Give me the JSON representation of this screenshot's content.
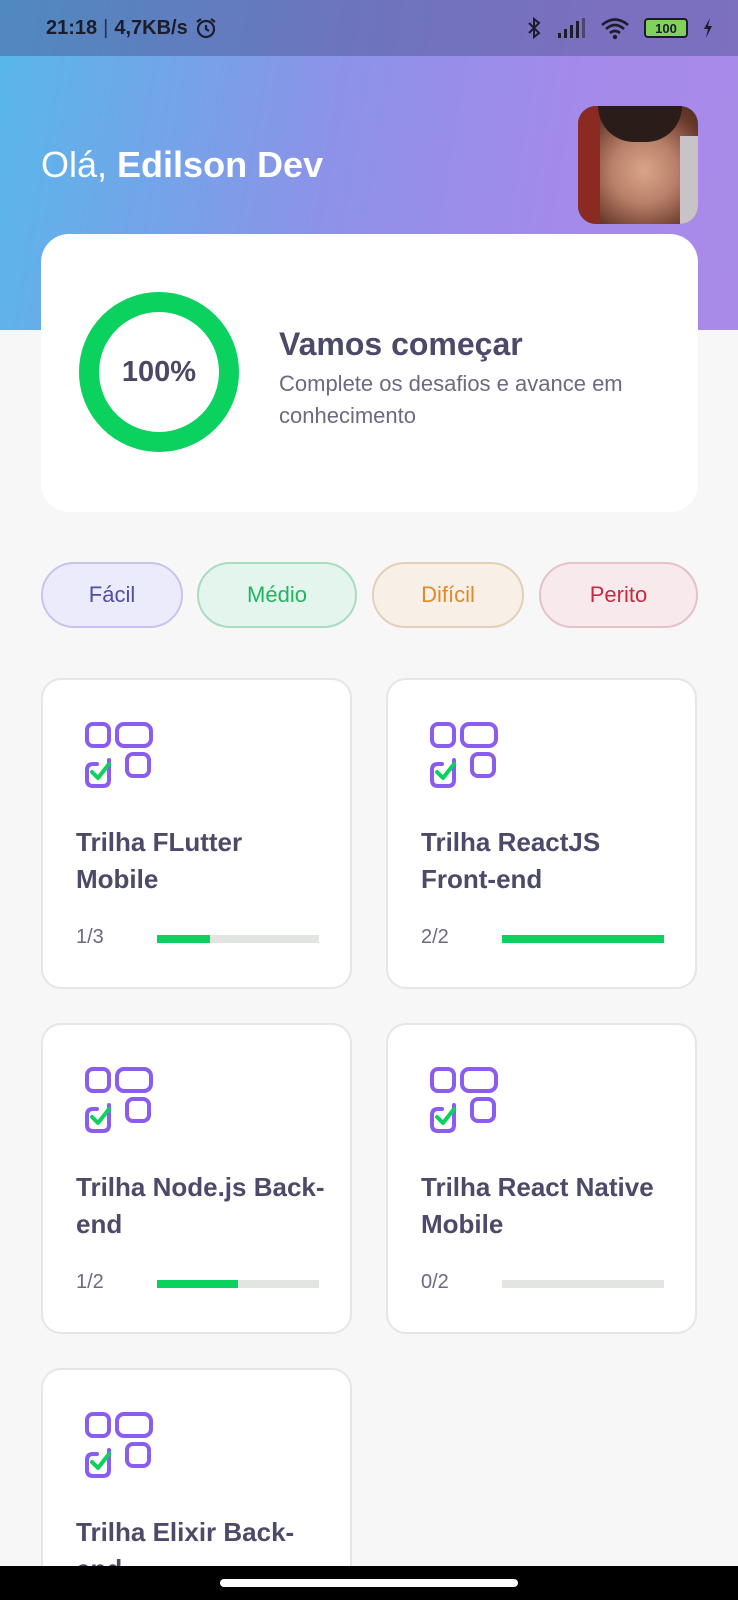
{
  "status_bar": {
    "time": "21:18",
    "speed": "4,7KB/s",
    "battery": "100",
    "icons": [
      "alarm-icon",
      "bluetooth-icon",
      "signal-icon",
      "wifi-icon",
      "battery-icon",
      "charging-icon"
    ]
  },
  "header": {
    "greeting_prefix": "Olá,",
    "user_name": "Edilson Dev"
  },
  "progress_card": {
    "percent_label": "100%",
    "percent": 100,
    "title": "Vamos começar",
    "subtitle": "Complete os desafios e avance em conhecimento",
    "ring_color": "#0bd15f"
  },
  "levels": [
    {
      "label": "Fácil"
    },
    {
      "label": "Médio"
    },
    {
      "label": "Difícil"
    },
    {
      "label": "Perito"
    }
  ],
  "tracks": [
    {
      "title": "Trilha FLutter Mobile",
      "count": "1/3",
      "progress": 0.333
    },
    {
      "title": "Trilha ReactJS Front-end",
      "count": "2/2",
      "progress": 1.0
    },
    {
      "title": "Trilha Node.js Back-end",
      "count": "1/2",
      "progress": 0.5
    },
    {
      "title": "Trilha React Native Mobile",
      "count": "0/2",
      "progress": 0.0
    },
    {
      "title": "Trilha Elixir Back-end",
      "count": "",
      "progress": 0.0
    }
  ],
  "colors": {
    "accent_purple": "#8a5cf0",
    "accent_green": "#0bd15f"
  }
}
